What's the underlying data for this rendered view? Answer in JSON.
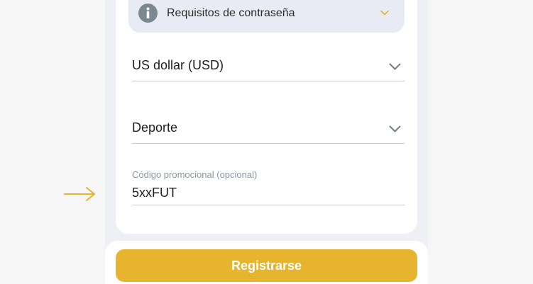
{
  "password_requirements": {
    "label": "Requisitos de contraseña",
    "icon": "info-icon",
    "expand_icon": "chevron-down-icon"
  },
  "currency_select": {
    "value": "US dollar (USD)",
    "icon": "chevron-down-icon"
  },
  "bonus_select": {
    "value": "Deporte",
    "icon": "chevron-down-icon"
  },
  "promo_code": {
    "label": "Código promocional (opcional)",
    "value": "5xxFUT"
  },
  "annotation": {
    "icon": "arrow-right-icon",
    "color": "#e6b42e"
  },
  "register_button": {
    "label": "Registrarse",
    "color": "#e6b42e"
  }
}
